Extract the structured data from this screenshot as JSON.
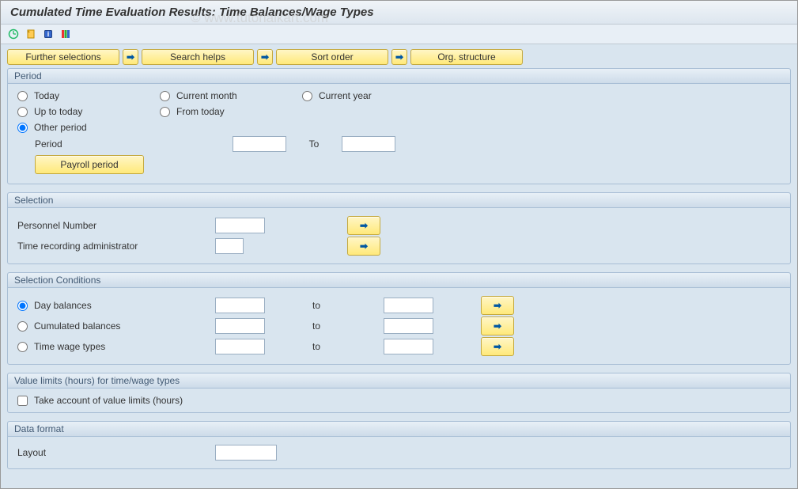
{
  "title": "Cumulated Time Evaluation Results: Time Balances/Wage Types",
  "watermark": "© www.tutorialkart.com",
  "topButtons": {
    "furtherSelections": "Further selections",
    "searchHelps": "Search helps",
    "sortOrder": "Sort order",
    "orgStructure": "Org. structure"
  },
  "period": {
    "title": "Period",
    "today": "Today",
    "currentMonth": "Current month",
    "currentYear": "Current year",
    "upToToday": "Up to today",
    "fromToday": "From today",
    "otherPeriod": "Other period",
    "periodLabel": "Period",
    "toLabel": "To",
    "periodFrom": "",
    "periodTo": "",
    "payrollPeriod": "Payroll period"
  },
  "selection": {
    "title": "Selection",
    "personnelNumber": "Personnel Number",
    "timeRecAdmin": "Time recording administrator",
    "personnelNumberVal": "",
    "timeRecAdminVal": ""
  },
  "selectionConditions": {
    "title": "Selection Conditions",
    "dayBalances": "Day balances",
    "cumulatedBalances": "Cumulated balances",
    "timeWageTypes": "Time wage types",
    "toLabel": "to",
    "dbFrom": "",
    "dbTo": "",
    "cbFrom": "",
    "cbTo": "",
    "twFrom": "",
    "twTo": ""
  },
  "valueLimits": {
    "title": "Value limits (hours) for time/wage types",
    "checkbox": "Take account of value limits (hours)"
  },
  "dataFormat": {
    "title": "Data format",
    "layoutLabel": "Layout",
    "layoutVal": ""
  }
}
